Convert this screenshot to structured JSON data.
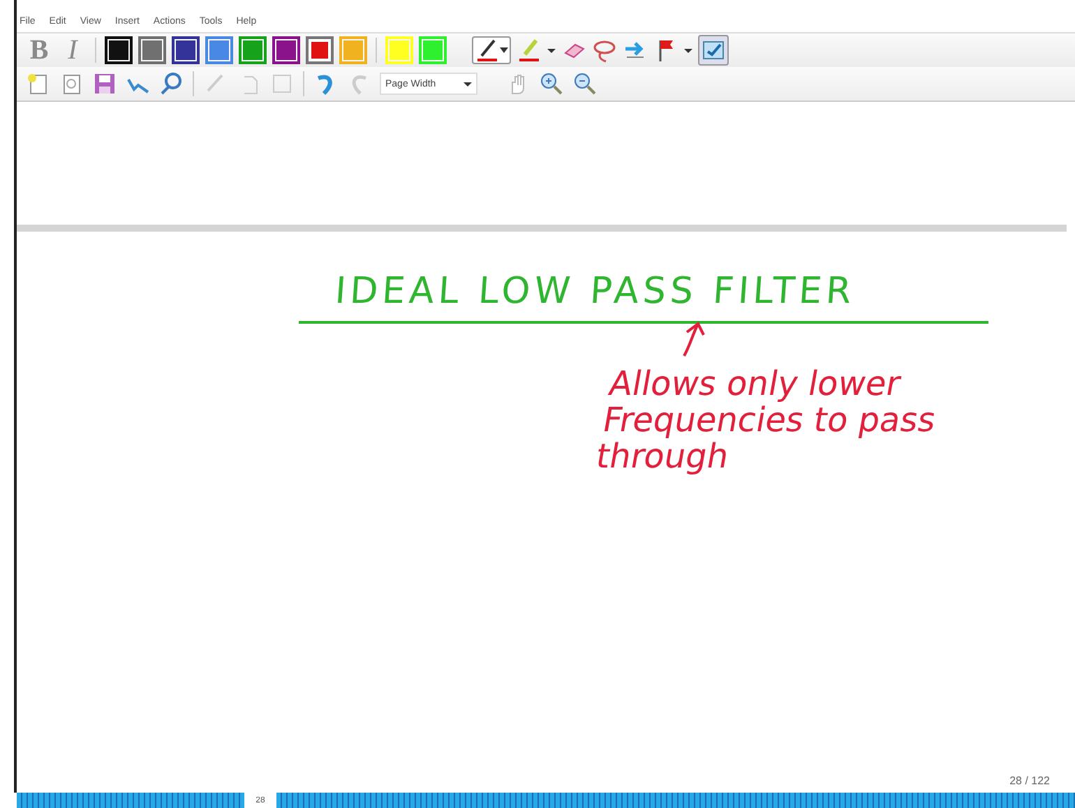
{
  "menu": [
    "File",
    "Edit",
    "View",
    "Insert",
    "Actions",
    "Tools",
    "Help"
  ],
  "format_buttons": [
    {
      "label": "B",
      "kind": "bold",
      "disabled": true
    },
    {
      "label": "I",
      "kind": "italic",
      "disabled": true
    }
  ],
  "pen_colors": [
    {
      "color": "#111111",
      "selected": false
    },
    {
      "color": "#707070",
      "selected": false
    },
    {
      "color": "#33339a",
      "selected": false
    },
    {
      "color": "#4a88e6",
      "selected": false
    },
    {
      "color": "#17a21c",
      "selected": false
    },
    {
      "color": "#8a138c",
      "selected": false
    },
    {
      "color": "#e01212",
      "selected": true
    },
    {
      "color": "#f0b21e",
      "selected": false
    },
    {
      "color": "#ffff22",
      "selected": false
    },
    {
      "color": "#2ff02f",
      "selected": false
    }
  ],
  "zoom_field": {
    "value": "Page Width"
  },
  "page": {
    "title_ink": {
      "text": "IDEAL LOW PASS FILTER",
      "color": "#2fb52f"
    },
    "note_ink": {
      "lines": [
        "Allows only lower",
        "Frequencies to pass",
        "through"
      ],
      "color": "#e2203c"
    },
    "page_counter": "28 / 122"
  },
  "bottom_bar": {
    "label": "28"
  }
}
